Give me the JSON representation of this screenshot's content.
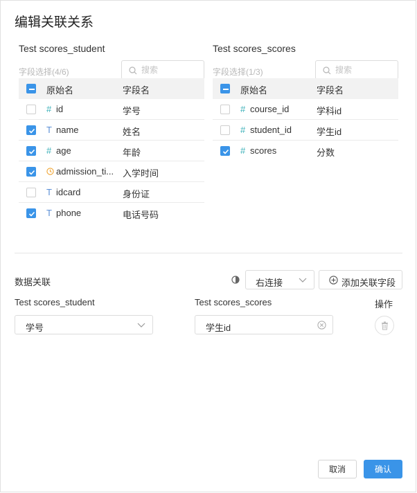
{
  "dialog": {
    "title": "编辑关联关系"
  },
  "left_panel": {
    "title": "Test scores_student",
    "count": "字段选择(4/6)",
    "search_placeholder": "搜索",
    "header": {
      "original_name": "原始名",
      "field_name": "字段名"
    },
    "rows": [
      {
        "type": "#",
        "original": "id",
        "field": "学号",
        "checked": false
      },
      {
        "type": "T",
        "original": "name",
        "field": "姓名",
        "checked": true
      },
      {
        "type": "#",
        "original": "age",
        "field": "年龄",
        "checked": true
      },
      {
        "type": "clock",
        "original": "admission_ti...",
        "field": "入学时间",
        "checked": true
      },
      {
        "type": "T",
        "original": "idcard",
        "field": "身份证",
        "checked": false
      },
      {
        "type": "T",
        "original": "phone",
        "field": "电话号码",
        "checked": true
      }
    ]
  },
  "right_panel": {
    "title": "Test scores_scores",
    "count": "字段选择(1/3)",
    "search_placeholder": "搜索",
    "header": {
      "original_name": "原始名",
      "field_name": "字段名"
    },
    "rows": [
      {
        "type": "#",
        "original": "course_id",
        "field": "学科id",
        "checked": false
      },
      {
        "type": "#",
        "original": "student_id",
        "field": "学生id",
        "checked": false
      },
      {
        "type": "#",
        "original": "scores",
        "field": "分数",
        "checked": true
      }
    ]
  },
  "relation": {
    "section_title": "数据关联",
    "join_type": "右连接",
    "add_button": "添加关联字段",
    "left_label": "Test scores_student",
    "right_label": "Test scores_scores",
    "action_label": "操作",
    "left_value": "学号",
    "right_value": "学生id"
  },
  "footer": {
    "cancel": "取消",
    "confirm": "确认"
  },
  "colors": {
    "primary": "#3a94e8",
    "number_icon": "#3bb0b8",
    "text_icon": "#5b8fd6",
    "time_icon": "#f0a431"
  },
  "icons": [
    "search-icon",
    "hash-icon",
    "text-type-icon",
    "clock-icon",
    "toggle-icon",
    "chevron-down-icon",
    "plus-circle-icon",
    "clear-icon",
    "trash-icon"
  ]
}
